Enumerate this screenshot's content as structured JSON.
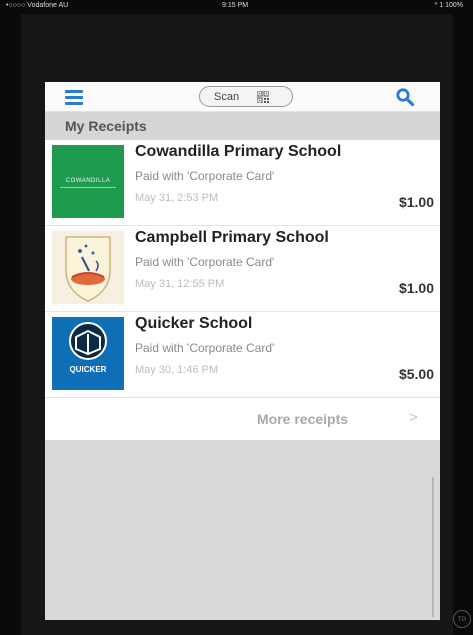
{
  "status_bar": {
    "carrier": "•○○○○ Vodafone AU",
    "time": "9:15 PM",
    "battery": "* 1 100%"
  },
  "navbar": {
    "scan_label": "Scan",
    "menu_icon": "hamburger-menu-icon",
    "qr_icon": "qr-code-icon",
    "search_icon": "search-icon",
    "accent_color": "#2a7bd6"
  },
  "section": {
    "title": "My Receipts"
  },
  "receipts": [
    {
      "school": "Cowandilla Primary School",
      "payment": "Paid with 'Corporate Card'",
      "date": "May 31, 2:53 PM",
      "amount": "$1.00",
      "logo_text": "COWANDILLA"
    },
    {
      "school": "Campbell Primary School",
      "payment": "Paid with 'Corporate Card'",
      "date": "May 31, 12:55 PM",
      "amount": "$1.00"
    },
    {
      "school": "Quicker School",
      "payment": "Paid with 'Corporate Card'",
      "date": "May 30, 1:46 PM",
      "amount": "$5.00",
      "logo_text": "QUICKER"
    }
  ],
  "more": {
    "label": "More receipts",
    "chevron": ">"
  },
  "corner_badge": "TG"
}
